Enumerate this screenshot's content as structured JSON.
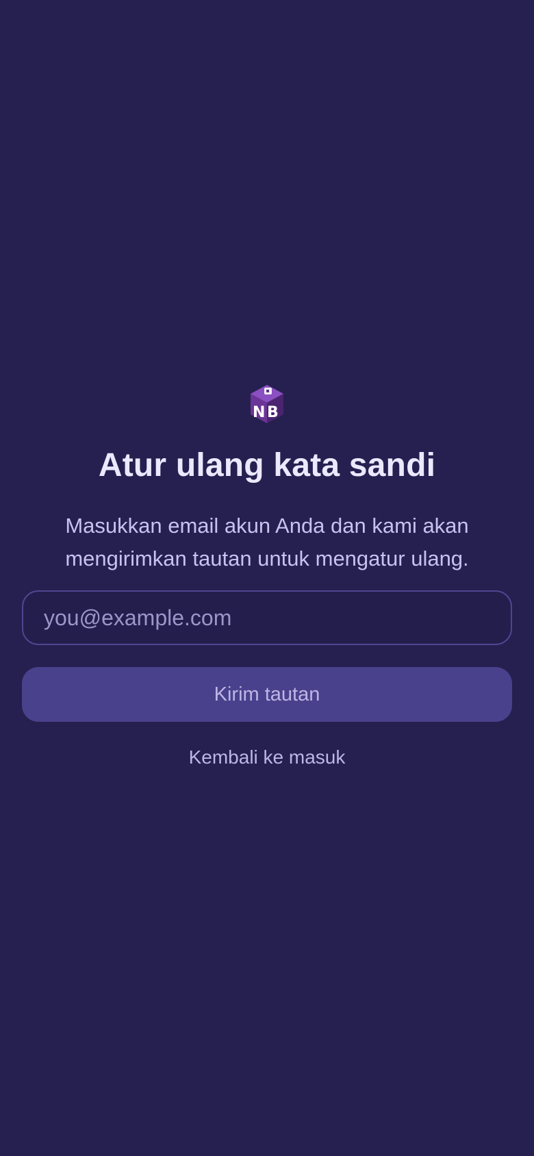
{
  "app": {
    "logo_icon": "nb-cube-logo-icon",
    "logo_text": "NB"
  },
  "page": {
    "title": "Atur ulang kata sandi",
    "subtitle": "Masukkan email akun Anda dan kami akan mengirimkan tautan untuk mengatur ulang."
  },
  "form": {
    "email": {
      "value": "",
      "placeholder": "you@example.com"
    },
    "submit_label": "Kirim tautan"
  },
  "links": {
    "back_to_login": "Kembali ke masuk"
  },
  "colors": {
    "background": "#25204f",
    "accent": "#49418b",
    "logo_purple": "#7b3fa8",
    "text_primary": "#ece8ff",
    "text_secondary": "#c9c1ee"
  }
}
